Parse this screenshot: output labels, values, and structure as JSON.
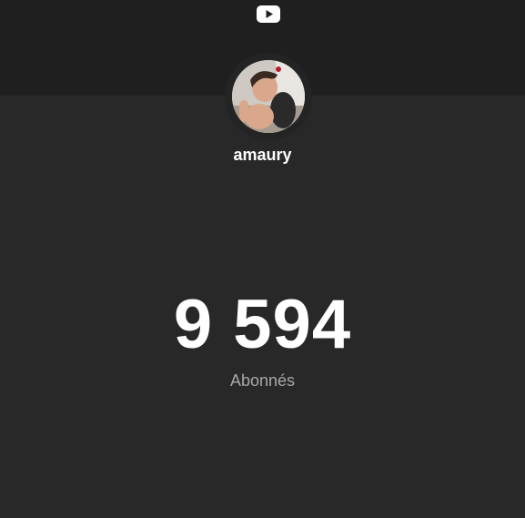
{
  "header": {
    "logo_icon": "youtube-icon"
  },
  "channel": {
    "name": "amaury",
    "avatar_icon": "channel-avatar"
  },
  "stats": {
    "subscriber_count": "9 594",
    "subscriber_label": "Abonnés"
  },
  "colors": {
    "background": "#282828",
    "header": "#1f1f1f",
    "text_primary": "#ffffff",
    "text_secondary": "#a8a8a8"
  }
}
